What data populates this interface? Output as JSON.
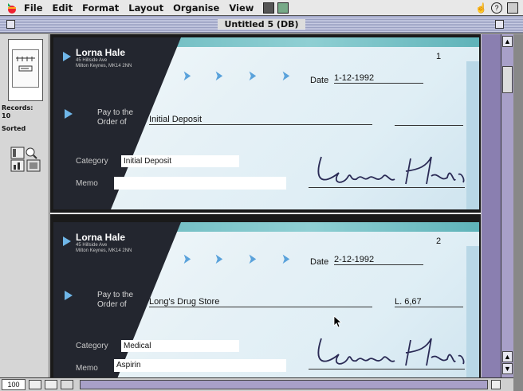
{
  "menubar": {
    "items": [
      "File",
      "Edit",
      "Format",
      "Layout",
      "Organise",
      "View"
    ]
  },
  "window": {
    "title": "Untitled 5 (DB)"
  },
  "status": {
    "records_label": "Records:",
    "records_count": "10",
    "sorted_label": "Sorted",
    "zoom": "100"
  },
  "checks": [
    {
      "number": "1",
      "name": "Lorna Hale",
      "address_line1": "45 Hillside Ave",
      "address_line2": "Milton Keynes, MK14 2NN",
      "date_label": "Date",
      "date": "1-12-1992",
      "pay_label": "Pay to the Order of",
      "payee": "Initial Deposit",
      "amount": "",
      "category_label": "Category",
      "category": "Initial Deposit",
      "memo_label": "Memo",
      "memo": "",
      "signature": "Lorna Hale"
    },
    {
      "number": "2",
      "name": "Lorna Hale",
      "address_line1": "45 Hillside Ave",
      "address_line2": "Milton Keynes, MK14 2NN",
      "date_label": "Date",
      "date": "2-12-1992",
      "pay_label": "Pay to the Order of",
      "payee": "Long's Drug Store",
      "amount": "L. 6,67",
      "category_label": "Category",
      "category": "Medical",
      "memo_label": "Memo",
      "memo": "Aspirin",
      "signature": "Lorna Hale"
    }
  ],
  "colors": {
    "accent_teal": "#5fb3b9",
    "dark_panel": "#23262f",
    "arrow_blue": "#5aa2db"
  }
}
